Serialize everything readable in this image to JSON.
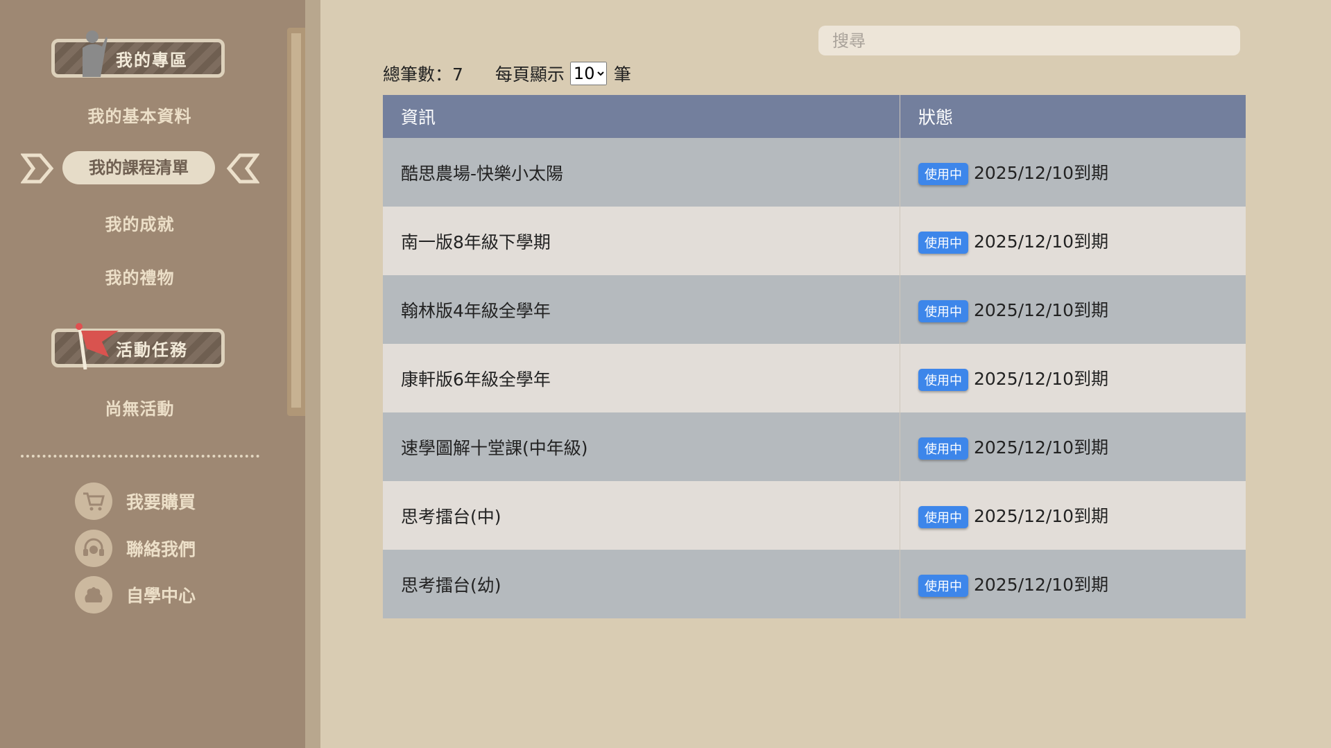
{
  "sidebar": {
    "my_area_banner": "我的專區",
    "items": [
      "我的基本資料",
      "我的課程清單",
      "我的成就",
      "我的禮物"
    ],
    "activity_banner": "活動任務",
    "activity_empty": "尚無活動",
    "tools": [
      {
        "label": "我要購買",
        "icon": "cart-icon"
      },
      {
        "label": "聯絡我們",
        "icon": "headset-icon"
      },
      {
        "label": "自學中心",
        "icon": "brain-icon"
      }
    ]
  },
  "search": {
    "placeholder": "搜尋"
  },
  "summary": {
    "total_label": "總筆數：7",
    "per_page_label": "每頁顯示",
    "per_page_value": "10",
    "unit": "筆"
  },
  "table": {
    "headers": [
      "資訊",
      "狀態"
    ],
    "rows": [
      {
        "info": "酷思農場-快樂小太陽",
        "badge": "使用中",
        "expiry": "2025/12/10到期"
      },
      {
        "info": "南一版8年級下學期",
        "badge": "使用中",
        "expiry": "2025/12/10到期"
      },
      {
        "info": "翰林版4年級全學年",
        "badge": "使用中",
        "expiry": "2025/12/10到期"
      },
      {
        "info": "康軒版6年級全學年",
        "badge": "使用中",
        "expiry": "2025/12/10到期"
      },
      {
        "info": "速學圖解十堂課(中年級)",
        "badge": "使用中",
        "expiry": "2025/12/10到期"
      },
      {
        "info": "思考擂台(中)",
        "badge": "使用中",
        "expiry": "2025/12/10到期"
      },
      {
        "info": "思考擂台(幼)",
        "badge": "使用中",
        "expiry": "2025/12/10到期"
      }
    ]
  },
  "colors": {
    "sidebar_bg": "#9e8873",
    "main_bg": "#d9ccb3",
    "table_header": "#737f9d",
    "badge": "#3d86ea"
  }
}
